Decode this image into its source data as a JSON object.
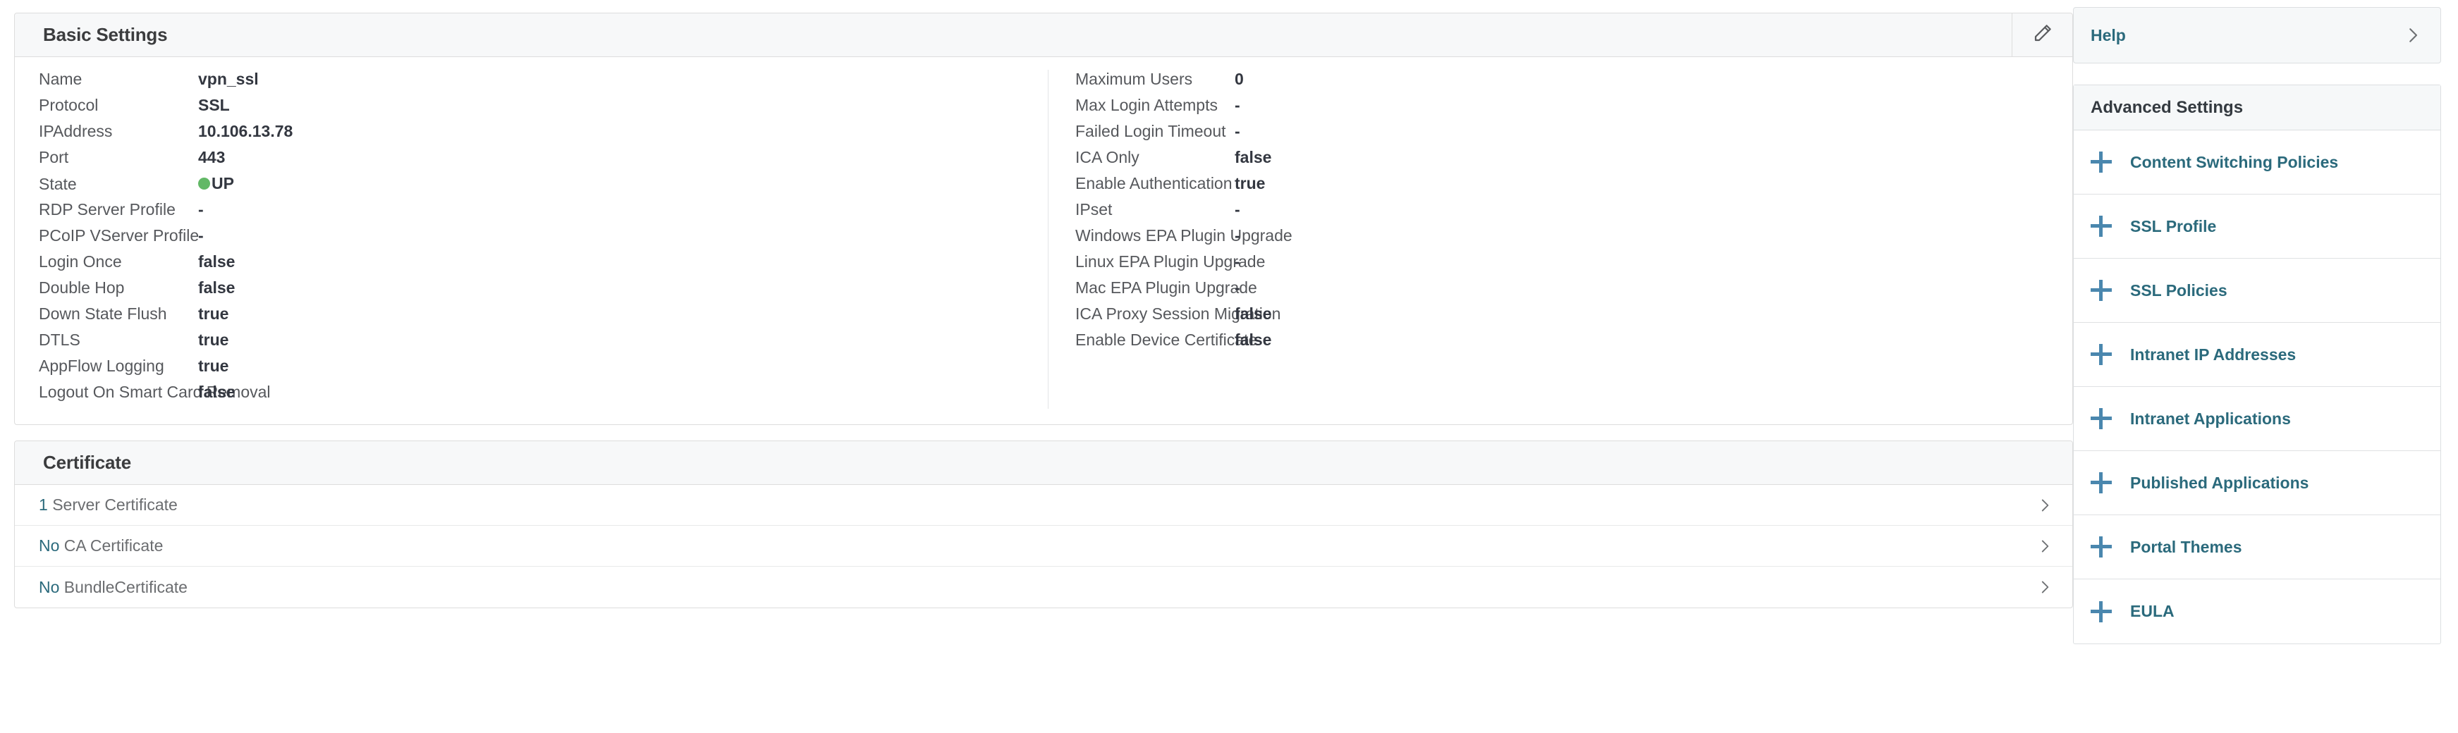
{
  "basic_settings": {
    "title": "Basic Settings",
    "edit_icon": "pencil-icon",
    "left_rows": [
      {
        "label": "Name",
        "value": "vpn_ssl"
      },
      {
        "label": "Protocol",
        "value": "SSL"
      },
      {
        "label": "IPAddress",
        "value": "10.106.13.78"
      },
      {
        "label": "Port",
        "value": "443"
      },
      {
        "label": "State",
        "value": "UP",
        "status": "up"
      },
      {
        "label": "RDP Server Profile",
        "value": "-"
      },
      {
        "label": "PCoIP VServer Profile",
        "value": "-"
      },
      {
        "label": "Login Once",
        "value": "false"
      },
      {
        "label": "Double Hop",
        "value": "false"
      },
      {
        "label": "Down State Flush",
        "value": "true"
      },
      {
        "label": "DTLS",
        "value": "true"
      },
      {
        "label": "AppFlow Logging",
        "value": "true"
      },
      {
        "label": "Logout On Smart Card Removal",
        "value": "false"
      }
    ],
    "right_rows": [
      {
        "label": "Maximum Users",
        "value": "0"
      },
      {
        "label": "Max Login Attempts",
        "value": "-"
      },
      {
        "label": "Failed Login Timeout",
        "value": "-"
      },
      {
        "label": "ICA Only",
        "value": "false"
      },
      {
        "label": "Enable Authentication",
        "value": "true"
      },
      {
        "label": "IPset",
        "value": "-"
      },
      {
        "label": "Windows EPA Plugin Upgrade",
        "value": "-"
      },
      {
        "label": "Linux EPA Plugin Upgrade",
        "value": "-"
      },
      {
        "label": "Mac EPA Plugin Upgrade",
        "value": "-"
      },
      {
        "label": "ICA Proxy Session Migration",
        "value": "false"
      },
      {
        "label": "Enable Device Certificate",
        "value": "false"
      }
    ]
  },
  "certificate": {
    "title": "Certificate",
    "rows": [
      {
        "count": "1",
        "label": "Server Certificate"
      },
      {
        "count": "No",
        "label": "CA Certificate"
      },
      {
        "count": "No",
        "label": "BundleCertificate"
      }
    ]
  },
  "help": {
    "label": "Help",
    "chevron_icon": "chevron-right-icon"
  },
  "advanced_settings": {
    "title": "Advanced Settings",
    "items": [
      {
        "label": "Content Switching Policies"
      },
      {
        "label": "SSL Profile"
      },
      {
        "label": "SSL Policies"
      },
      {
        "label": "Intranet IP Addresses"
      },
      {
        "label": "Intranet Applications"
      },
      {
        "label": "Published Applications"
      },
      {
        "label": "Portal Themes"
      },
      {
        "label": "EULA"
      }
    ]
  },
  "colors": {
    "link_teal": "#2b6a7c",
    "plus_blue": "#4a87ae",
    "status_up_green": "#62b866",
    "panel_header_bg": "#f7f8f9",
    "border": "#dddddd"
  }
}
